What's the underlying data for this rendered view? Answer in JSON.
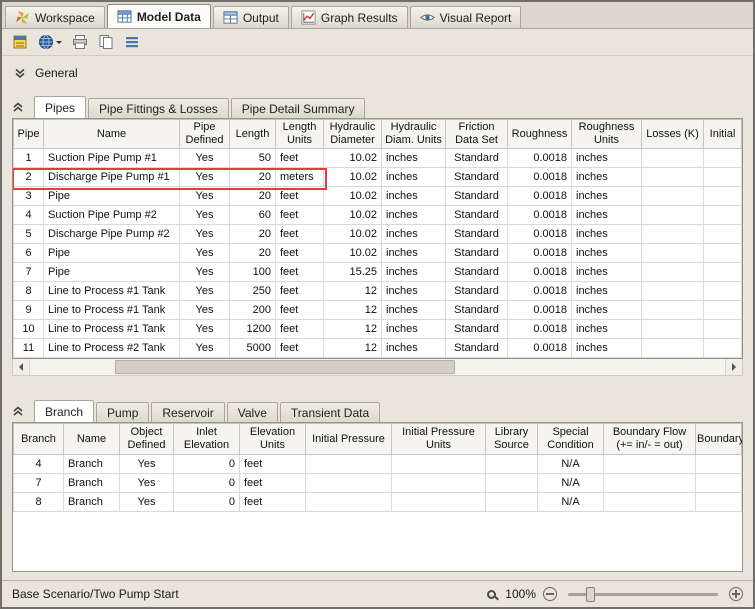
{
  "main_tabs": {
    "items": [
      {
        "label": "Workspace",
        "icon": "workspace-icon"
      },
      {
        "label": "Model Data",
        "icon": "model-data-icon"
      },
      {
        "label": "Output",
        "icon": "output-icon"
      },
      {
        "label": "Graph Results",
        "icon": "graph-results-icon"
      },
      {
        "label": "Visual Report",
        "icon": "visual-report-icon"
      }
    ]
  },
  "toolbar": {
    "buttons": [
      {
        "icon": "model-data-settings-icon"
      },
      {
        "icon": "globe-icon"
      },
      {
        "icon": "print-icon"
      },
      {
        "icon": "copy-icon"
      },
      {
        "icon": "notes-list-icon"
      }
    ]
  },
  "general": {
    "label": "General"
  },
  "pipes": {
    "tabs": [
      {
        "label": "Pipes"
      },
      {
        "label": "Pipe Fittings & Losses"
      },
      {
        "label": "Pipe Detail Summary"
      }
    ],
    "headers": [
      "Pipe",
      "Name",
      "Pipe Defined",
      "Length",
      "Length Units",
      "Hydraulic Diameter",
      "Hydraulic Diam. Units",
      "Friction Data Set",
      "Roughness",
      "Roughness Units",
      "Losses (K)",
      "Initial"
    ],
    "rows": [
      [
        "1",
        "Suction Pipe Pump #1",
        "Yes",
        "50",
        "feet",
        "10.02",
        "inches",
        "Standard",
        "0.0018",
        "inches",
        "",
        ""
      ],
      [
        "2",
        "Discharge Pipe Pump #1",
        "Yes",
        "20",
        "meters",
        "10.02",
        "inches",
        "Standard",
        "0.0018",
        "inches",
        "",
        ""
      ],
      [
        "3",
        "Pipe",
        "Yes",
        "20",
        "feet",
        "10.02",
        "inches",
        "Standard",
        "0.0018",
        "inches",
        "",
        ""
      ],
      [
        "4",
        "Suction Pipe Pump #2",
        "Yes",
        "60",
        "feet",
        "10.02",
        "inches",
        "Standard",
        "0.0018",
        "inches",
        "",
        ""
      ],
      [
        "5",
        "Discharge Pipe Pump #2",
        "Yes",
        "20",
        "feet",
        "10.02",
        "inches",
        "Standard",
        "0.0018",
        "inches",
        "",
        ""
      ],
      [
        "6",
        "Pipe",
        "Yes",
        "20",
        "feet",
        "10.02",
        "inches",
        "Standard",
        "0.0018",
        "inches",
        "",
        ""
      ],
      [
        "7",
        "Pipe",
        "Yes",
        "100",
        "feet",
        "15.25",
        "inches",
        "Standard",
        "0.0018",
        "inches",
        "",
        ""
      ],
      [
        "8",
        "Line to Process #1 Tank",
        "Yes",
        "250",
        "feet",
        "12",
        "inches",
        "Standard",
        "0.0018",
        "inches",
        "",
        ""
      ],
      [
        "9",
        "Line to Process #1 Tank",
        "Yes",
        "200",
        "feet",
        "12",
        "inches",
        "Standard",
        "0.0018",
        "inches",
        "",
        ""
      ],
      [
        "10",
        "Line to Process #1 Tank",
        "Yes",
        "1200",
        "feet",
        "12",
        "inches",
        "Standard",
        "0.0018",
        "inches",
        "",
        ""
      ],
      [
        "11",
        "Line to Process #2 Tank",
        "Yes",
        "5000",
        "feet",
        "12",
        "inches",
        "Standard",
        "0.0018",
        "inches",
        "",
        ""
      ]
    ],
    "highlighted_row": 2,
    "highlight_color": "#e23c3c"
  },
  "branches": {
    "tabs": [
      {
        "label": "Branch"
      },
      {
        "label": "Pump"
      },
      {
        "label": "Reservoir"
      },
      {
        "label": "Valve"
      },
      {
        "label": "Transient Data"
      }
    ],
    "headers": [
      "Branch",
      "Name",
      "Object Defined",
      "Inlet Elevation",
      "Elevation Units",
      "Initial Pressure",
      "Initial Pressure Units",
      "Library Source",
      "Special Condition",
      "Boundary Flow (+= in/- = out)",
      "Boundary"
    ],
    "rows": [
      [
        "4",
        "Branch",
        "Yes",
        "0",
        "feet",
        "",
        "",
        "",
        "N/A",
        "",
        ""
      ],
      [
        "7",
        "Branch",
        "Yes",
        "0",
        "feet",
        "",
        "",
        "",
        "N/A",
        "",
        ""
      ],
      [
        "8",
        "Branch",
        "Yes",
        "0",
        "feet",
        "",
        "",
        "",
        "N/A",
        "",
        ""
      ]
    ]
  },
  "status_bar": {
    "scenario_path": "Base Scenario/Two Pump Start",
    "zoom_level": "100%"
  }
}
